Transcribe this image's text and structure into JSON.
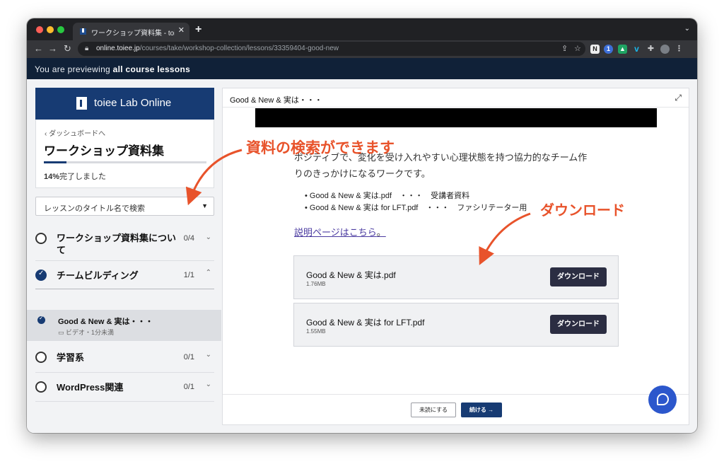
{
  "browser": {
    "tab_title": "ワークショップ資料集 - toiee Lab",
    "tab_close": "✕",
    "new_tab": "+",
    "url_host": "online.toiee.jp",
    "url_path": "/courses/take/workshop-collection/lessons/33359404-good-new"
  },
  "banner": {
    "prefix": "You are previewing",
    "emphasis": "all course lessons"
  },
  "sidebar": {
    "school_name": "toiee Lab Online",
    "back_link": "‹ ダッシュボードへ",
    "course_title": "ワークショップ資料集",
    "progress_value": 14,
    "progress_percent": "14%",
    "progress_suffix": "完了しました",
    "search_placeholder": "レッスンのタイトル名で検索",
    "chapters": [
      {
        "title": "ワークショップ資料集につい",
        "title_cont": "て",
        "count": "0/4",
        "completed": false
      },
      {
        "title": "チームビルディング",
        "count": "1/1",
        "completed": true
      },
      {
        "title": "学習系",
        "count": "0/1",
        "completed": false
      },
      {
        "title": "WordPress関連",
        "count": "0/1",
        "completed": false
      }
    ],
    "active_lesson": {
      "title": "Good & New & 実は・・・",
      "meta": "ビデオ・1分未満"
    }
  },
  "main": {
    "heading": "Good & New & 実は・・・",
    "description_line1": "ポジティブで、変化を受け入れやすい心理状態を持つ協力的なチーム作",
    "description_line2": "りのきっかけになるワークです。",
    "files": [
      "Good & New & 実は.pdf　・・・　受講者資料",
      "Good & New & 実は for LFT.pdf　・・・　ファシリテーター用"
    ],
    "info_link": "説明ページはこちら",
    "info_link_suffix": "。",
    "downloads": [
      {
        "name": "Good & New & 実は.pdf",
        "size": "1.76MB",
        "button": "ダウンロード"
      },
      {
        "name": "Good & New & 実は for LFT.pdf",
        "size": "1.55MB",
        "button": "ダウンロード"
      }
    ],
    "btn_incomplete": "未読にする",
    "btn_continue": "続ける →"
  },
  "annotations": {
    "search_note": "資料の検索ができます",
    "download_note": "ダウンロード",
    "color": "#e8532b"
  }
}
